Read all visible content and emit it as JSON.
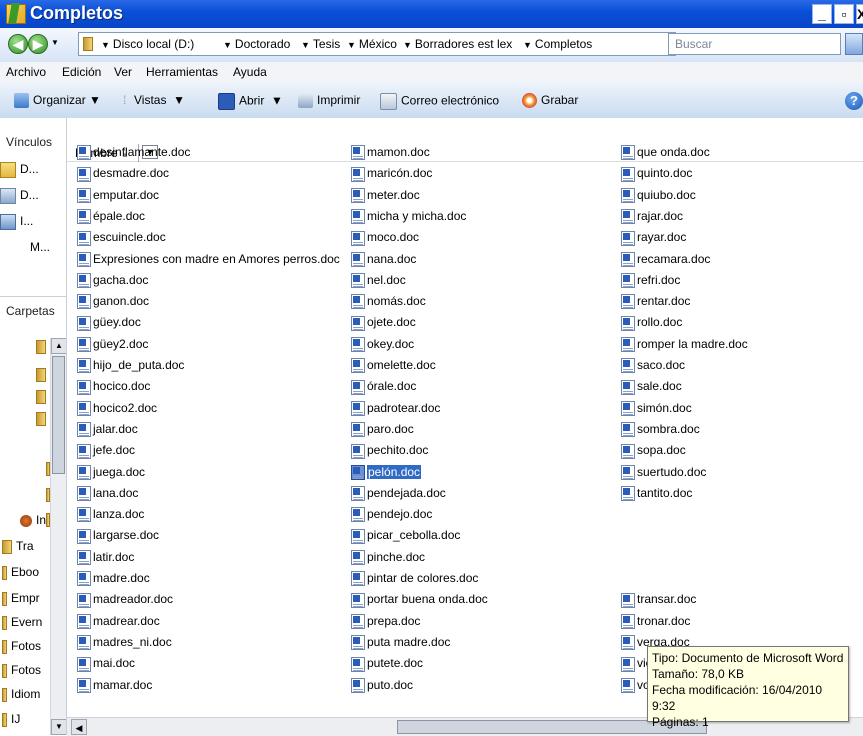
{
  "window": {
    "title": "Completos"
  },
  "address": {
    "crumbs": [
      "Disco local (D:)",
      "Doctorado",
      "Tesis",
      "México",
      "Borradores est lex",
      "Completos"
    ]
  },
  "search": {
    "placeholder": "Buscar"
  },
  "menu": [
    "Archivo",
    "Edición",
    "Ver",
    "Herramientas",
    "Ayuda"
  ],
  "toolbar": {
    "organize": "Organizar",
    "views": "Vistas",
    "open": "Abrir",
    "print": "Imprimir",
    "email": "Correo electrónico",
    "burn": "Grabar"
  },
  "leftnav": {
    "links_header": "Vínculos",
    "links": [
      "D...",
      "D...",
      "I...",
      "M..."
    ],
    "folders_header": "Carpetas",
    "folders": [
      "In",
      "Tra",
      "Eboo",
      "Empr",
      "Evern",
      "Fotos",
      "Fotos",
      "Idiom",
      "IJ"
    ]
  },
  "column_header": "Nombre",
  "files": {
    "col1": [
      "desinflamante.doc",
      "desmadre.doc",
      "emputar.doc",
      "épale.doc",
      "escuincle.doc",
      "Expresiones con madre en Amores perros.doc",
      "gacha.doc",
      "ganon.doc",
      "güey.doc",
      "güey2.doc",
      "hijo_de_puta.doc",
      "hocico.doc",
      "hocico2.doc",
      "jalar.doc",
      "jefe.doc",
      "juega.doc",
      "lana.doc",
      "lanza.doc",
      "largarse.doc",
      "latir.doc",
      "madre.doc",
      "madreador.doc",
      "madrear.doc",
      "madres_ni.doc",
      "mai.doc",
      "mamar.doc"
    ],
    "col2": [
      "mamon.doc",
      "maricón.doc",
      "meter.doc",
      "micha y micha.doc",
      "moco.doc",
      "nana.doc",
      "nel.doc",
      "nomás.doc",
      "ojete.doc",
      "okey.doc",
      "omelette.doc",
      "órale.doc",
      "padrotear.doc",
      "paro.doc",
      "pechito.doc",
      "pelón.doc",
      "pendejada.doc",
      "pendejo.doc",
      "picar_cebolla.doc",
      "pinche.doc",
      "pintar de colores.doc",
      "portar buena onda.doc",
      "prepa.doc",
      "puta madre.doc",
      "putete.doc",
      "puto.doc"
    ],
    "col3": [
      "que onda.doc",
      "quinto.doc",
      "quiubo.doc",
      "rajar.doc",
      "rayar.doc",
      "recamara.doc",
      "refri.doc",
      "rentar.doc",
      "rollo.doc",
      "romper la madre.doc",
      "saco.doc",
      "sale.doc",
      "simón.doc",
      "sombra.doc",
      "sopa.doc",
      "suertudo.doc",
      "tantito.doc",
      "",
      "",
      "",
      "",
      "transar.doc",
      "tronar.doc",
      "verga.doc",
      "vieja.doc",
      "volada.doc"
    ]
  },
  "selected_file": "pelón.doc",
  "tooltip": {
    "line1": "Tipo: Documento de Microsoft Word",
    "line2": "Tamaño: 78,0 KB",
    "line3": "Fecha modificación: 16/04/2010 9:32",
    "line4": "Páginas: 1"
  }
}
